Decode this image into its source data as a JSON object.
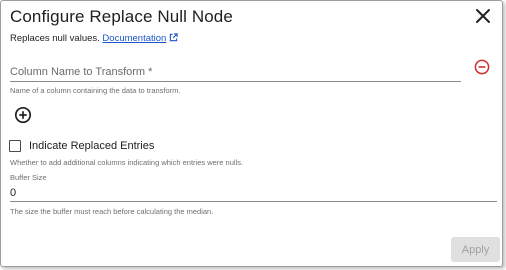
{
  "dialog": {
    "title": "Configure Replace Null Node",
    "close_icon": "close-icon",
    "description": "Replaces null values.",
    "doc_link": "Documentation",
    "doc_link_icon": "external-link-icon"
  },
  "column_field": {
    "placeholder": "Column Name to Transform *",
    "value": "",
    "hint": "Name of a column containing the data to transform.",
    "remove_icon": "remove-circle-icon",
    "remove_color": "#d32f2f"
  },
  "add_column": {
    "icon": "add-circle-icon"
  },
  "indicate_replaced": {
    "label": "Indicate Replaced Entries",
    "checked": false,
    "hint": "Whether to add additional columns indicating which entries were nulls."
  },
  "buffer_size": {
    "label": "Buffer Size",
    "value": "0",
    "hint": "The size the buffer must reach before calculating the median."
  },
  "footer": {
    "apply_label": "Apply",
    "apply_disabled": true
  }
}
